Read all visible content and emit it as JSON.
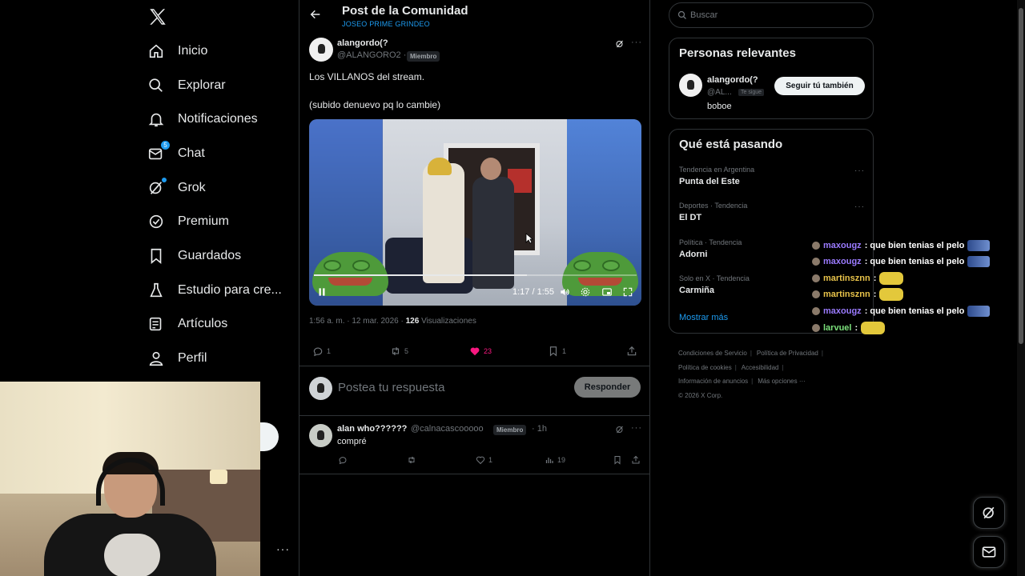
{
  "nav": {
    "items": [
      {
        "label": "Inicio",
        "icon": "home-icon"
      },
      {
        "label": "Explorar",
        "icon": "search-icon"
      },
      {
        "label": "Notificaciones",
        "icon": "bell-icon"
      },
      {
        "label": "Chat",
        "icon": "mail-icon",
        "badge": "5"
      },
      {
        "label": "Grok",
        "icon": "grok-icon"
      },
      {
        "label": "Premium",
        "icon": "verified-icon"
      },
      {
        "label": "Guardados",
        "icon": "bookmark-icon"
      },
      {
        "label": "Estudio para cre...",
        "icon": "flask-icon"
      },
      {
        "label": "Artículos",
        "icon": "article-icon"
      },
      {
        "label": "Perfil",
        "icon": "person-icon"
      }
    ]
  },
  "header": {
    "title": "Post de la Comunidad",
    "community": "JOSEO PRIME GRINDEO"
  },
  "post": {
    "author_name": "alangordo(?",
    "handle": "@ALANGORO2 ·",
    "member": "Miembro",
    "line1": "Los VILLANOS del stream.",
    "line2": "(subido denuevo pq lo cambie)",
    "video_time": "1:17 / 1:55",
    "video_progress": 0.66,
    "timestamp": "1:56 a. m. · 12 mar. 2026 ·",
    "views_count": "126",
    "views_label": "Visualizaciones",
    "replies": "1",
    "reposts": "5",
    "likes": "23",
    "bookmarks": "1"
  },
  "reply_box": {
    "placeholder": "Postea tu respuesta",
    "button": "Responder"
  },
  "reply": {
    "author_name": "alan who??????",
    "handle": "@calnacascooooo",
    "member": "Miembro",
    "time": "· 1h",
    "text": "compré",
    "likes": "1",
    "views": "19"
  },
  "search": {
    "placeholder": "Buscar"
  },
  "relevant": {
    "title": "Personas relevantes",
    "name": "alangordo(?",
    "handle": "@AL...",
    "follows_you": "Te sigue",
    "bio": "boboe",
    "follow_button": "Seguir tú también"
  },
  "trending": {
    "title": "Qué está pasando",
    "items": [
      {
        "category": "Tendencia en Argentina",
        "name": "Punta del Este"
      },
      {
        "category": "Deportes · Tendencia",
        "name": "El DT"
      },
      {
        "category": "Política · Tendencia",
        "name": "Adorni"
      },
      {
        "category": "Solo en X · Tendencia",
        "name": "Carmiña"
      }
    ],
    "show_more": "Mostrar más"
  },
  "footer": {
    "links": [
      "Condiciones de Servicio",
      "Política de Privacidad",
      "Política de cookies",
      "Accesibilidad",
      "Información de anuncios",
      "Más opciones ···"
    ],
    "copyright": "© 2026 X Corp."
  },
  "chat_overlay": [
    {
      "user": "maxougz",
      "message": ": que bien tenias el pelo",
      "color": "#9b7bff"
    },
    {
      "user": "maxougz",
      "message": ": que bien tenias el pelo",
      "color": "#9b7bff"
    },
    {
      "user": "martinsznn",
      "message": ":",
      "color": "#e8c34a"
    },
    {
      "user": "martinsznn",
      "message": ":",
      "color": "#e8c34a"
    },
    {
      "user": "maxougz",
      "message": ": que bien tenias el pelo",
      "color": "#9b7bff"
    },
    {
      "user": "larvuel",
      "message": ":",
      "color": "#7be07b"
    }
  ],
  "colors": {
    "accent": "#1d9bf0",
    "like": "#f91880",
    "background": "#000000",
    "border": "#2f3336"
  }
}
